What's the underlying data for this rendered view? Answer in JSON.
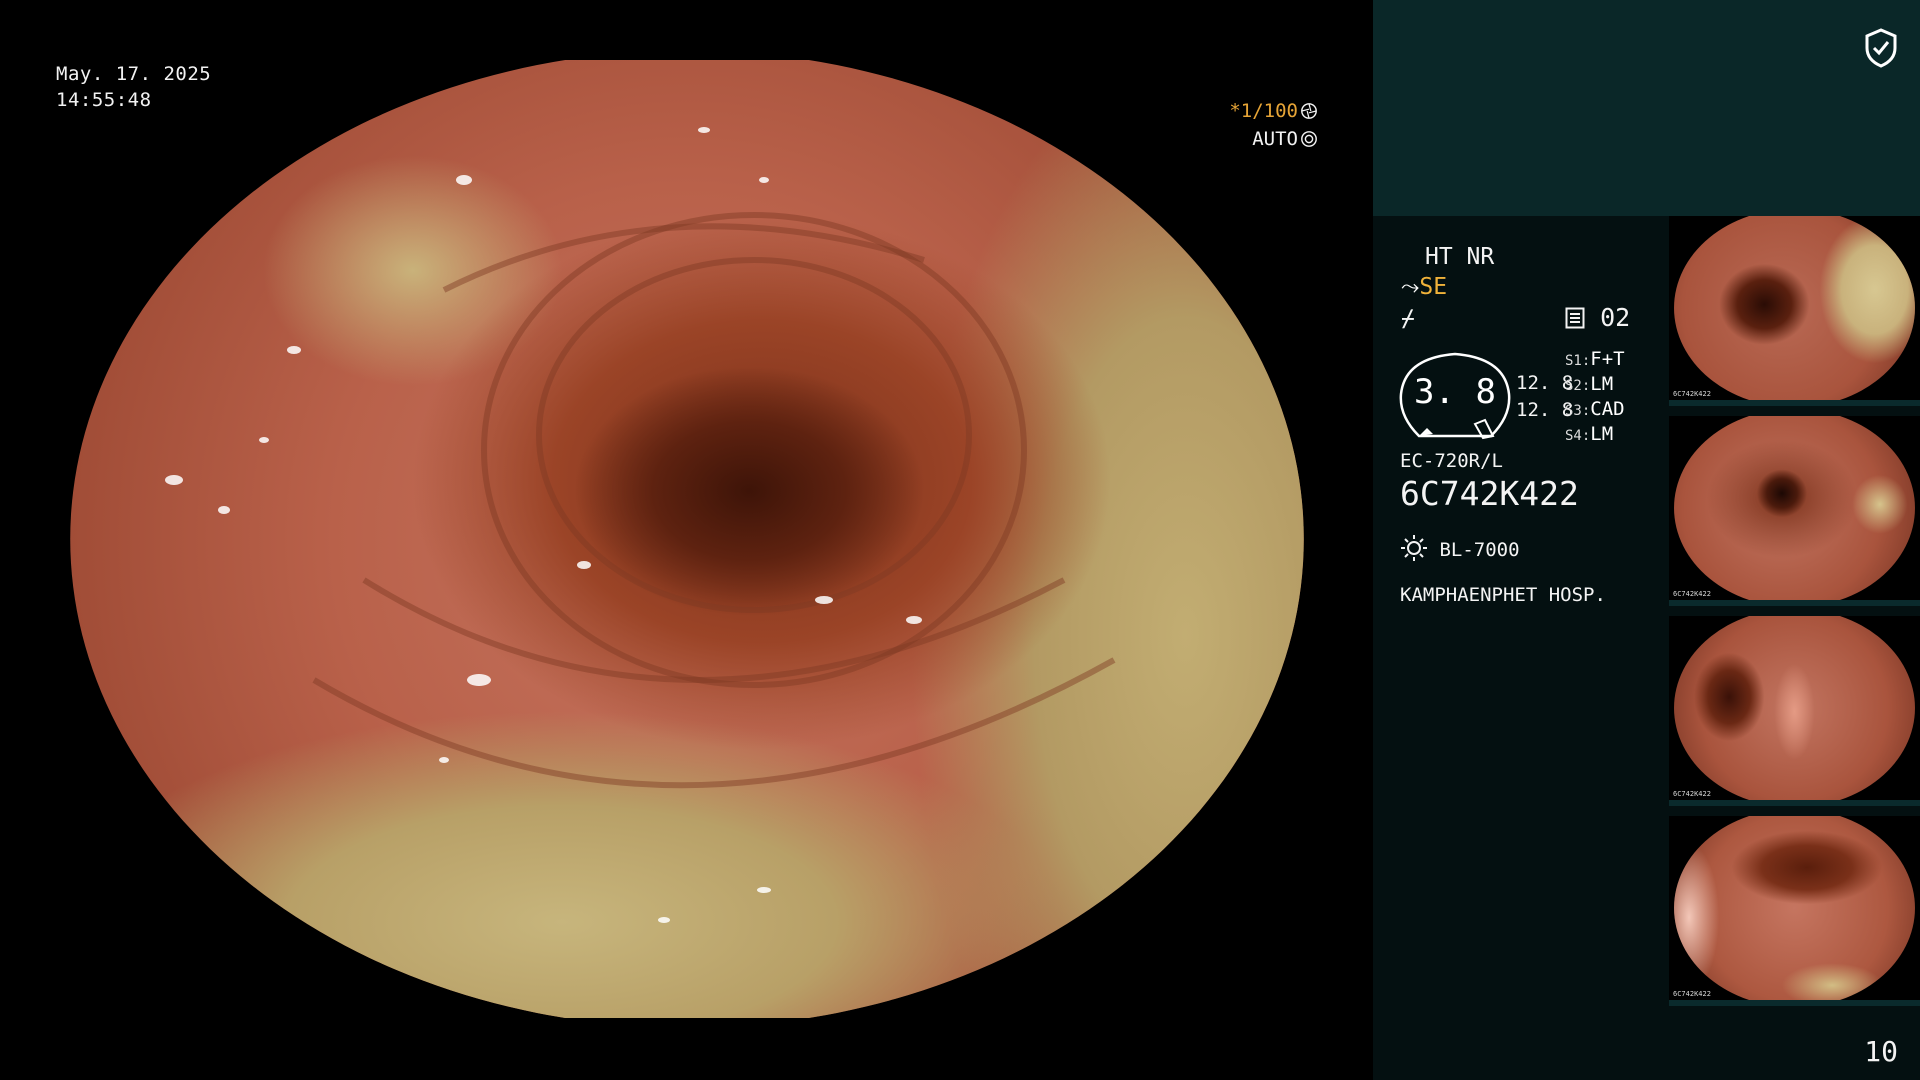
{
  "overlay": {
    "date": "May. 17. 2025",
    "time": "14:55:48",
    "shutter": "*1/100",
    "shutter_icon": "aperture-icon",
    "iris_mode": "AUTO",
    "iris_icon": "iris-icon"
  },
  "panel": {
    "shield_icon": "shield-check-icon",
    "mode": "HT NR",
    "structure_enhancement": "SE",
    "memory_label": "02",
    "gauge_value": "3. 8",
    "value_a": "12. 8",
    "value_b": "12. 8",
    "switches": [
      {
        "key": "S1",
        "value": "F+T"
      },
      {
        "key": "S2",
        "value": "LM"
      },
      {
        "key": "S3",
        "value": "CAD"
      },
      {
        "key": "S4",
        "value": "LM"
      }
    ],
    "scope_model": "EC-720R/L",
    "serial": "6C742K422",
    "light_source": "BL-7000",
    "hospital": "KAMPHAENPHET HOSP.",
    "page_number": "10"
  },
  "thumbnails": [
    {
      "serial": "6C742K422"
    },
    {
      "serial": "6C742K422"
    },
    {
      "serial": "6C742K422"
    },
    {
      "serial": "6C742K422"
    }
  ],
  "colors": {
    "shutter_accent": "#e6a436",
    "se_accent": "#f0b23a",
    "panel_top": "#0a2728",
    "panel_bg": "#041011"
  }
}
